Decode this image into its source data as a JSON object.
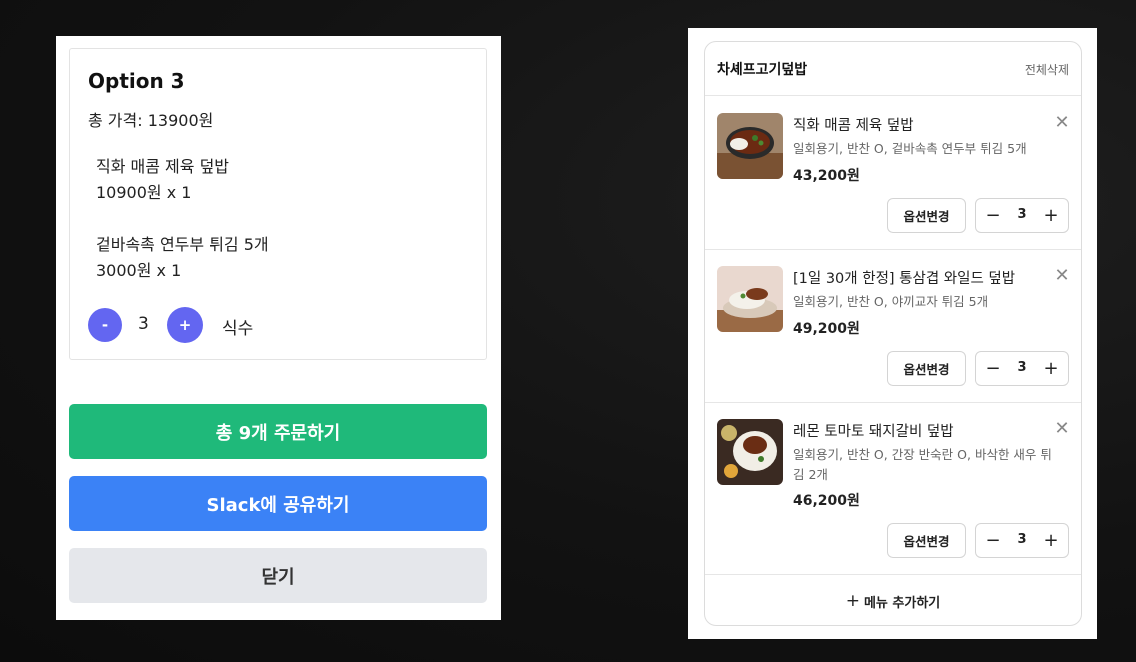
{
  "option_panel": {
    "title": "Option 3",
    "total_price": "총 가격: 13900원",
    "items": [
      {
        "name": "직화 매콤 제육 덮밥",
        "price_qty": "10900원 x 1"
      },
      {
        "name": "겉바속촉 연두부 튀김 5개",
        "price_qty": "3000원 x 1"
      }
    ],
    "minus_label": "-",
    "quantity": "3",
    "plus_label": "+",
    "unit_label": "식수",
    "order_button": "총 9개 주문하기",
    "slack_button": "Slack에 공유하기",
    "close_button": "닫기",
    "colors": {
      "order": "#1fb97a",
      "slack": "#3b82f6",
      "close": "#e5e7eb",
      "stepper": "#6366f1"
    }
  },
  "cart": {
    "store_name": "차셰프고기덮밥",
    "delete_all": "전체삭제",
    "items": [
      {
        "name": "직화 매콤 제육 덮밥",
        "options": "일회용기, 반찬 O, 겉바속촉 연두부 튀김 5개",
        "price": "43,200원",
        "option_change": "옵션변경",
        "quantity": "3"
      },
      {
        "name": "[1일 30개 한정] 통삼겹 와일드 덮밥",
        "options": "일회용기, 반찬 O, 야끼교자 튀김 5개",
        "price": "49,200원",
        "option_change": "옵션변경",
        "quantity": "3"
      },
      {
        "name": "레몬 토마토 돼지갈비 덮밥",
        "options": "일회용기, 반찬 O, 간장 반숙란 O, 바삭한 새우 튀김 2개",
        "price": "46,200원",
        "option_change": "옵션변경",
        "quantity": "3"
      }
    ],
    "close_glyph": "✕",
    "minus_glyph": "−",
    "plus_glyph": "+",
    "add_menu_plus": "+",
    "add_menu": "메뉴 추가하기"
  }
}
